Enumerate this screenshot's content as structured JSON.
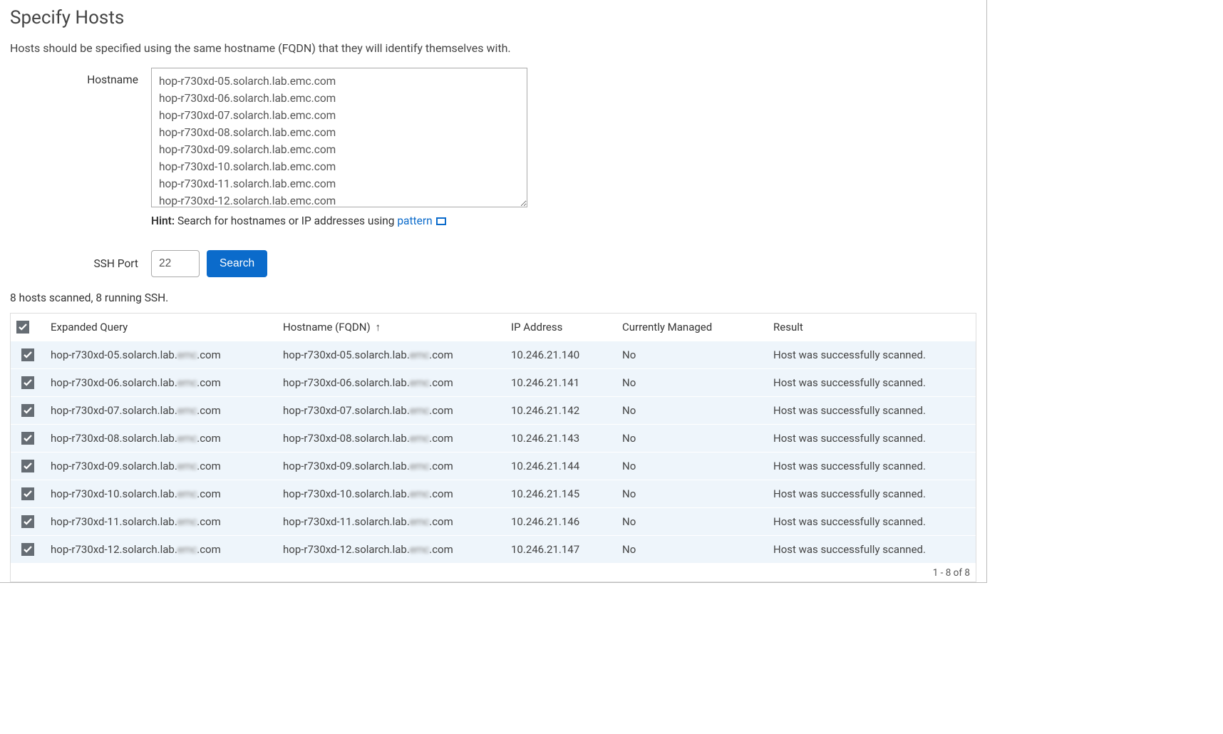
{
  "header": {
    "title": "Specify Hosts",
    "description": "Hosts should be specified using the same hostname (FQDN) that they will identify themselves with."
  },
  "form": {
    "hostname_label": "Hostname",
    "hostname_blur_domain": "emc",
    "hostnames": [
      "hop-r730xd-05.solarch.lab.",
      "hop-r730xd-06.solarch.lab.",
      "hop-r730xd-07.solarch.lab.",
      "hop-r730xd-08.solarch.lab.",
      "hop-r730xd-09.solarch.lab.",
      "hop-r730xd-10.solarch.lab.",
      "hop-r730xd-11.solarch.lab.",
      "hop-r730xd-12.solarch.lab."
    ],
    "hostname_suffix": ".com",
    "hint_label": "Hint:",
    "hint_text": " Search for hostnames or IP addresses using ",
    "hint_link": "pattern",
    "ssh_port_label": "SSH Port",
    "ssh_port_value": "22",
    "search_button": "Search"
  },
  "scan_status": "8 hosts scanned, 8 running SSH.",
  "table": {
    "columns": {
      "expanded": "Expanded Query",
      "fqdn": "Hostname (FQDN)",
      "sort_indicator": "↑",
      "ip": "IP Address",
      "managed": "Currently Managed",
      "result": "Result"
    },
    "host_prefix": "hop-r730xd-",
    "host_mid": ".solarch.lab.",
    "host_blur": "emc",
    "host_suffix": ".com",
    "rows": [
      {
        "checked": true,
        "num": "05",
        "ip": "10.246.21.140",
        "managed": "No",
        "result": "Host was successfully scanned."
      },
      {
        "checked": true,
        "num": "06",
        "ip": "10.246.21.141",
        "managed": "No",
        "result": "Host was successfully scanned."
      },
      {
        "checked": true,
        "num": "07",
        "ip": "10.246.21.142",
        "managed": "No",
        "result": "Host was successfully scanned."
      },
      {
        "checked": true,
        "num": "08",
        "ip": "10.246.21.143",
        "managed": "No",
        "result": "Host was successfully scanned."
      },
      {
        "checked": true,
        "num": "09",
        "ip": "10.246.21.144",
        "managed": "No",
        "result": "Host was successfully scanned."
      },
      {
        "checked": true,
        "num": "10",
        "ip": "10.246.21.145",
        "managed": "No",
        "result": "Host was successfully scanned."
      },
      {
        "checked": true,
        "num": "11",
        "ip": "10.246.21.146",
        "managed": "No",
        "result": "Host was successfully scanned."
      },
      {
        "checked": true,
        "num": "12",
        "ip": "10.246.21.147",
        "managed": "No",
        "result": "Host was successfully scanned."
      }
    ]
  },
  "pager": {
    "text": "1 - 8 of 8"
  }
}
